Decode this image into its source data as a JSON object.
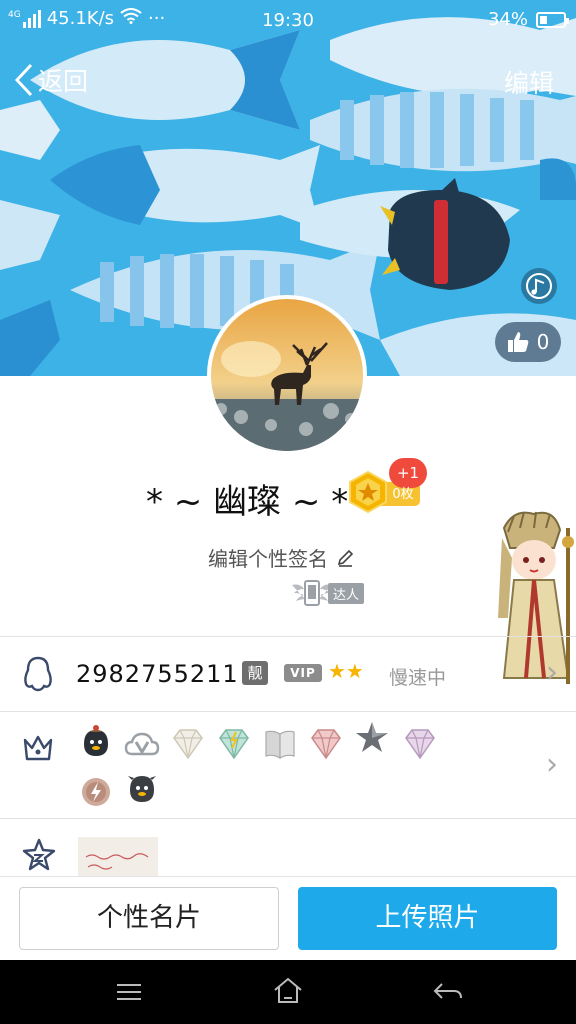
{
  "status_bar": {
    "network_type": "4G",
    "speed": "45.1K/s",
    "more": "···",
    "time": "19:30",
    "battery": "34%",
    "battery_level": 0.34
  },
  "nav": {
    "back_label": "返回",
    "edit_label": "编辑"
  },
  "likes": {
    "count": "0"
  },
  "profile": {
    "nickname": "* ~ 幽璨 ~ *",
    "medal_plus": "+1",
    "medal_count": "0枚",
    "signature": "编辑个性签名",
    "daren_tag": "达人"
  },
  "info": {
    "qq_number": "2982755211",
    "liang": "靓",
    "vip": "VIP",
    "stars": "★★",
    "speed_status": "慢速中"
  },
  "buttons": {
    "card": "个性名片",
    "upload": "上传照片"
  },
  "colors": {
    "cover_blue": "#3bb0e4",
    "upload_blue": "#1ea9ea",
    "badge_red": "#f04a3d",
    "medal_gold": "#f5b400"
  },
  "icons": {
    "nav": [
      "menu-icon",
      "home-icon",
      "back-nav-icon"
    ],
    "row_icons": [
      "penguin-icon",
      "crown-icon",
      "star-outline-icon"
    ],
    "badges": [
      "penguin-hat-badge",
      "cloud-v-badge",
      "diamond-white-badge",
      "diamond-green-badge",
      "book-badge",
      "diamond-red-badge",
      "star-dark-badge",
      "diamond-purple-badge",
      "lightning-badge",
      "penguin-small-badge"
    ]
  }
}
